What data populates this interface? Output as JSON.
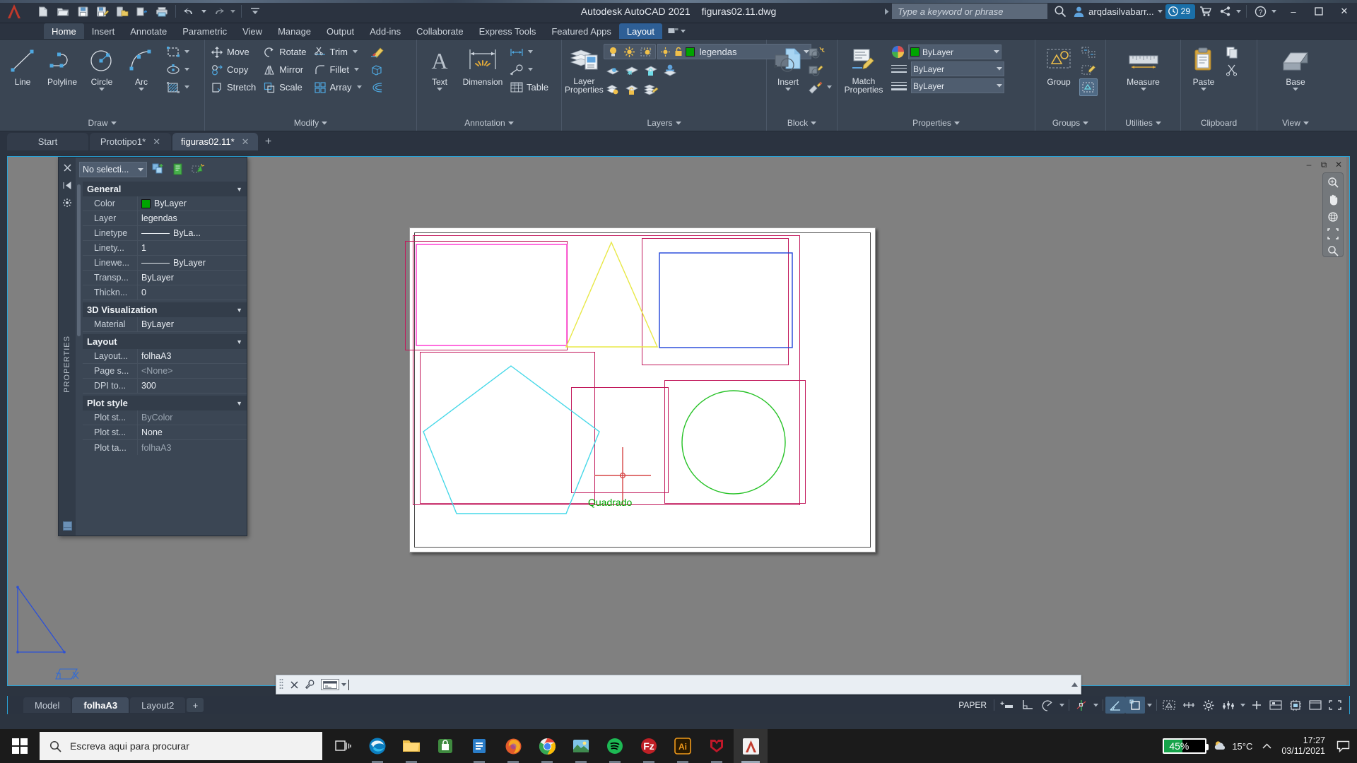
{
  "titlebar": {
    "app_title": "Autodesk AutoCAD 2021",
    "file_name": "figuras02.11.dwg",
    "search_placeholder": "Type a keyword or phrase",
    "user_name": "arqdasilvabarr...",
    "notification_count": "29",
    "quick_access": [
      "new-icon",
      "open-icon",
      "save-icon",
      "save-as-icon",
      "save-to-web-icon",
      "plot-icon",
      "print-icon",
      "undo-icon",
      "redo-icon"
    ],
    "window_controls": {
      "minimize": "–",
      "maximize": "❐",
      "close": "✕"
    }
  },
  "ribbon_tabs": [
    {
      "label": "Home",
      "state": "active"
    },
    {
      "label": "Insert",
      "state": "normal"
    },
    {
      "label": "Annotate",
      "state": "normal"
    },
    {
      "label": "Parametric",
      "state": "normal"
    },
    {
      "label": "View",
      "state": "normal"
    },
    {
      "label": "Manage",
      "state": "normal"
    },
    {
      "label": "Output",
      "state": "normal"
    },
    {
      "label": "Add-ins",
      "state": "normal"
    },
    {
      "label": "Collaborate",
      "state": "normal"
    },
    {
      "label": "Express Tools",
      "state": "normal"
    },
    {
      "label": "Featured Apps",
      "state": "normal"
    },
    {
      "label": "Layout",
      "state": "highlight"
    }
  ],
  "ribbon": {
    "draw": {
      "title": "Draw",
      "buttons": [
        {
          "label": "Line",
          "icon": "line-icon"
        },
        {
          "label": "Polyline",
          "icon": "polyline-icon"
        },
        {
          "label": "Circle",
          "icon": "circle-icon",
          "dropdown": true
        },
        {
          "label": "Arc",
          "icon": "arc-icon",
          "dropdown": true
        }
      ],
      "small_icons": [
        "rectangle-icon",
        "ellipse-icon",
        "hatch-icon"
      ]
    },
    "modify": {
      "title": "Modify",
      "items": [
        {
          "label": "Move",
          "icon": "move-icon"
        },
        {
          "label": "Rotate",
          "icon": "rotate-icon"
        },
        {
          "label": "Trim",
          "icon": "trim-icon",
          "dropdown": true
        },
        {
          "label": "Copy",
          "icon": "copy-icon"
        },
        {
          "label": "Mirror",
          "icon": "mirror-icon"
        },
        {
          "label": "Fillet",
          "icon": "fillet-icon",
          "dropdown": true
        },
        {
          "label": "Stretch",
          "icon": "stretch-icon"
        },
        {
          "label": "Scale",
          "icon": "scale-icon"
        },
        {
          "label": "Array",
          "icon": "array-icon",
          "dropdown": true
        }
      ],
      "extra_icons": [
        "erase-icon",
        "explode-icon",
        "offset-icon"
      ]
    },
    "annotation": {
      "title": "Annotation",
      "buttons": [
        {
          "label": "Text",
          "icon": "text-icon",
          "dropdown": true
        },
        {
          "label": "Dimension",
          "icon": "dimension-icon"
        }
      ],
      "items": [
        {
          "label": "Table",
          "icon": "table-icon"
        }
      ],
      "small_icons": [
        "linear-dimension-icon",
        "leader-icon"
      ]
    },
    "layers": {
      "title": "Layers",
      "button": {
        "label_line1": "Layer",
        "label_line2": "Properties",
        "icon": "layer-properties-icon"
      },
      "current_layer": "legendas",
      "layer_color": "#00a400",
      "state_icons": [
        "layer-on-icon",
        "layer-freeze-icon",
        "layer-lock-icon"
      ],
      "tool_icons": [
        "layer-off-icon",
        "layer-freeze-icon",
        "layer-lock-icon",
        "layer-isolate-icon",
        "layer-on-all-icon",
        "layer-unlock-icon",
        "layer-merge-icon"
      ]
    },
    "block": {
      "title": "Block",
      "button": {
        "label": "Insert",
        "icon": "insert-block-icon",
        "dropdown": true
      },
      "small_icons": [
        "create-block-icon",
        "edit-block-icon",
        "block-attribute-icon"
      ]
    },
    "properties": {
      "title": "Properties",
      "button": {
        "label_line1": "Match",
        "label_line2": "Properties",
        "icon": "match-properties-icon"
      },
      "color_value": "ByLayer",
      "linetype_value": "ByLayer",
      "lineweight_value": "ByLayer",
      "swatch_color": "#00a400",
      "palette_icon": "color-wheel-icon"
    },
    "groups": {
      "title": "Groups",
      "button": {
        "label": "Group",
        "icon": "group-icon"
      },
      "small_icons": [
        "ungroup-icon",
        "group-edit-icon",
        "group-selection-icon"
      ]
    },
    "utilities": {
      "title": "Utilities",
      "button": {
        "label": "Measure",
        "icon": "measure-icon",
        "dropdown": true
      }
    },
    "clipboard": {
      "title": "Clipboard",
      "button": {
        "label": "Paste",
        "icon": "paste-icon",
        "dropdown": true
      },
      "small_icons": [
        "copy-clip-icon",
        "cut-clip-icon"
      ]
    },
    "view": {
      "title": "View",
      "button": {
        "label": "Base",
        "icon": "base-view-icon",
        "dropdown": true
      }
    }
  },
  "file_tabs": [
    {
      "label": "Start",
      "closable": false,
      "active": false
    },
    {
      "label": "Prototipo1*",
      "closable": true,
      "active": false
    },
    {
      "label": "figuras02.11*",
      "closable": true,
      "active": true
    }
  ],
  "file_tab_add": "+",
  "properties_palette": {
    "panel_label": "PROPERTIES",
    "selection": "No selecti...",
    "gutter_icons": [
      "close-icon",
      "autohide-icon",
      "palette-settings-icon"
    ],
    "top_icons": [
      "quick-select-icon",
      "select-objects-icon",
      "pickadd-icon"
    ],
    "groups": [
      {
        "name": "General",
        "rows": [
          {
            "key": "Color",
            "value": "ByLayer",
            "swatch": "#00a400"
          },
          {
            "key": "Layer",
            "value": "legendas"
          },
          {
            "key": "Linetype",
            "value": "ByLa...",
            "line": true
          },
          {
            "key": "Linety...",
            "value": "1"
          },
          {
            "key": "Linewe...",
            "value": "ByLayer",
            "line": true
          },
          {
            "key": "Transp...",
            "value": "ByLayer"
          },
          {
            "key": "Thickn...",
            "value": "0"
          }
        ]
      },
      {
        "name": "3D Visualization",
        "rows": [
          {
            "key": "Material",
            "value": "ByLayer"
          }
        ]
      },
      {
        "name": "Layout",
        "rows": [
          {
            "key": "Layout...",
            "value": "folhaA3"
          },
          {
            "key": "Page s...",
            "value": "<None>",
            "dim": true
          },
          {
            "key": "DPI to...",
            "value": "300"
          }
        ]
      },
      {
        "name": "Plot style",
        "rows": [
          {
            "key": "Plot st...",
            "value": "ByColor",
            "dim": true
          },
          {
            "key": "Plot st...",
            "value": "None"
          },
          {
            "key": "Plot ta...",
            "value": "folhaA3",
            "dim": true
          }
        ]
      }
    ]
  },
  "canvas": {
    "drawing_label": "Quadrado",
    "drawing_label_color": "#00a400",
    "viewport_border_color": "#c2185b",
    "entities": [
      {
        "name": "magenta-rectangle",
        "color": "#ff2fd0"
      },
      {
        "name": "yellow-triangle",
        "color": "#e8e846"
      },
      {
        "name": "blue-rectangle",
        "color": "#1f43d8"
      },
      {
        "name": "cyan-pentagon",
        "color": "#46d8e8"
      },
      {
        "name": "red-crosshair",
        "color": "#d64545"
      },
      {
        "name": "green-circle",
        "color": "#26c226"
      }
    ],
    "viewport_controls": [
      "minimize-vp-icon",
      "restore-vp-icon",
      "close-vp-icon"
    ],
    "navcube_icons": [
      "viewcube-icon",
      "zoom-extents-icon",
      "pan-icon",
      "orbit-icon",
      "zoom-window-icon"
    ]
  },
  "command_line": {
    "value": "",
    "prompt_icon": "command-prompt-icon",
    "icons": [
      "close-cmd-icon",
      "customize-cmd-icon"
    ]
  },
  "layout_tabs": [
    {
      "label": "Model",
      "active": false
    },
    {
      "label": "folhaA3",
      "active": true
    },
    {
      "label": "Layout2",
      "active": false
    }
  ],
  "layout_tab_add": "+",
  "status_bar": {
    "space_label": "PAPER",
    "items": [
      {
        "name": "model-space-icon",
        "on": false
      },
      {
        "name": "ortho-icon",
        "on": false
      },
      {
        "name": "polar-tracking-icon",
        "on": false,
        "dropdown": true
      },
      {
        "name": "object-snap-icon",
        "on": false,
        "dropdown": true
      },
      {
        "name": "isodraft-icon",
        "on": true
      },
      {
        "name": "annotation-visibility-icon",
        "on": true,
        "dropdown": true
      },
      {
        "name": "viewport-scale-icon",
        "on": false
      },
      {
        "name": "annotation-scale-icon",
        "on": false
      },
      {
        "name": "workspace-switching-icon",
        "on": false
      },
      {
        "name": "customization-icon",
        "on": false,
        "dropdown": true
      },
      {
        "name": "hardware-accel-icon",
        "on": false
      },
      {
        "name": "isolate-objects-icon",
        "on": false
      },
      {
        "name": "clean-screen-icon",
        "on": false
      },
      {
        "name": "fullscreen-icon",
        "on": false
      }
    ]
  },
  "taskbar": {
    "search_placeholder": "Escreva aqui para procurar",
    "apps": [
      {
        "name": "task-view-icon",
        "state": "normal"
      },
      {
        "name": "edge-icon",
        "state": "running"
      },
      {
        "name": "file-explorer-icon",
        "state": "running"
      },
      {
        "name": "store-icon",
        "state": "normal"
      },
      {
        "name": "libre-office-icon",
        "state": "running"
      },
      {
        "name": "firefox-icon",
        "state": "running"
      },
      {
        "name": "chrome-icon",
        "state": "running"
      },
      {
        "name": "photos-icon",
        "state": "running"
      },
      {
        "name": "spotify-icon",
        "state": "running"
      },
      {
        "name": "filezilla-icon",
        "state": "running"
      },
      {
        "name": "illustrator-icon",
        "state": "running"
      },
      {
        "name": "mcafee-icon",
        "state": "running"
      },
      {
        "name": "autocad-icon",
        "state": "active"
      }
    ],
    "battery_percent": "45%",
    "battery_level": 45,
    "temperature": "15°C",
    "time": "17:27",
    "date": "03/11/2021",
    "tray_icons": [
      "weather-icon",
      "show-hidden-icon",
      "notifications-icon"
    ]
  }
}
